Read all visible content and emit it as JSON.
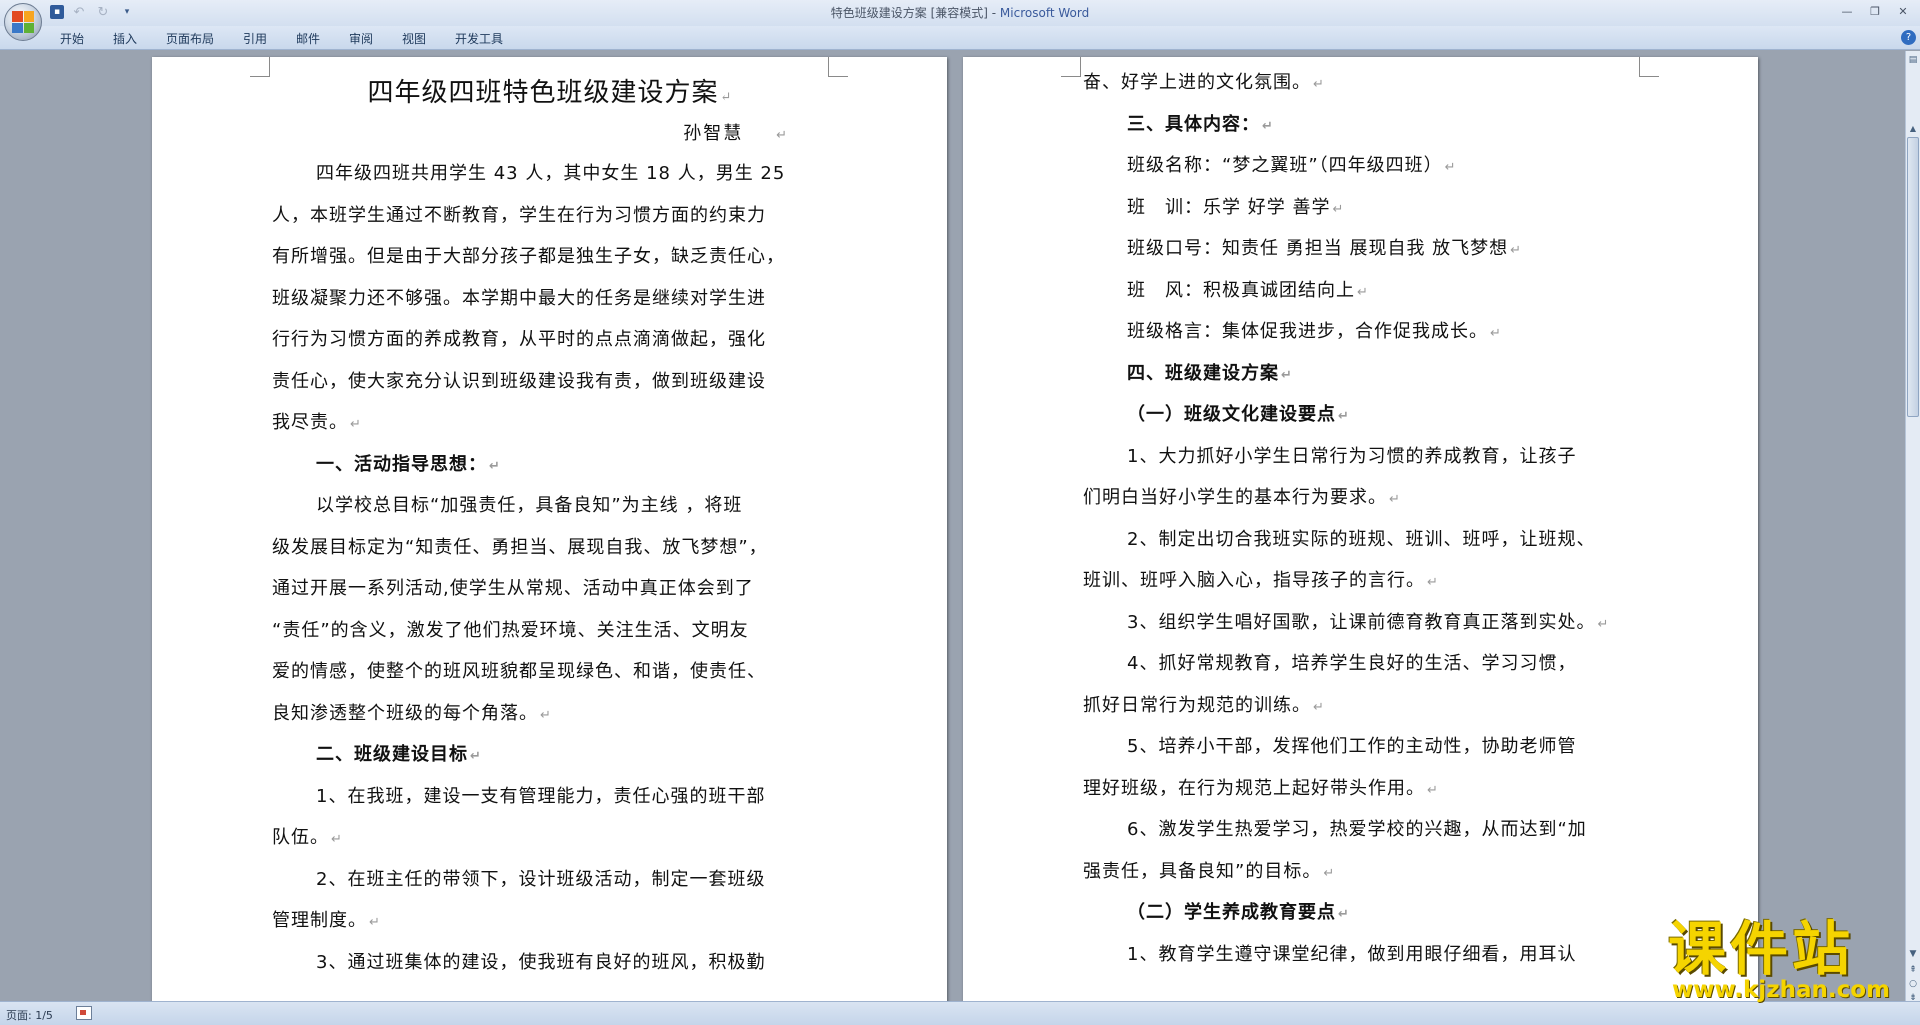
{
  "window": {
    "title_doc": "特色班级建设方案 [兼容模式] - ",
    "title_app": "Microsoft Word"
  },
  "ribbon": {
    "tabs": [
      "开始",
      "插入",
      "页面布局",
      "引用",
      "邮件",
      "审阅",
      "视图",
      "开发工具"
    ]
  },
  "page_left": {
    "title": "四年级四班特色班级建设方案",
    "author": "孙智慧",
    "lines": [
      {
        "text": "四年级四班共用学生 43 人，其中女生 18 人，男生 25",
        "indent": true
      },
      {
        "text": "人，本班学生通过不断教育，学生在行为习惯方面的约束力",
        "indent": false
      },
      {
        "text": "有所增强。但是由于大部分孩子都是独生子女，缺乏责任心，",
        "indent": false
      },
      {
        "text": "班级凝聚力还不够强。本学期中最大的任务是继续对学生进",
        "indent": false
      },
      {
        "text": "行行为习惯方面的养成教育，从平时的点点滴滴做起，强化",
        "indent": false
      },
      {
        "text": "责任心，使大家充分认识到班级建设我有责，做到班级建设",
        "indent": false
      },
      {
        "text": "我尽责。",
        "indent": false,
        "pm": true
      },
      {
        "text": "一、活动指导思想：",
        "indent": true,
        "heading": true,
        "pm": true
      },
      {
        "text": "以学校总目标“加强责任，具备良知”为主线 ，将班",
        "indent": true
      },
      {
        "text": "级发展目标定为“知责任、勇担当、展现自我、放飞梦想”，",
        "indent": false
      },
      {
        "text": "通过开展一系列活动,使学生从常规、活动中真正体会到了",
        "indent": false
      },
      {
        "text": "“责任”的含义，激发了他们热爱环境、关注生活、文明友",
        "indent": false
      },
      {
        "text": "爱的情感，使整个的班风班貌都呈现绿色、和谐，使责任、",
        "indent": false
      },
      {
        "text": "良知渗透整个班级的每个角落。",
        "indent": false,
        "pm": true
      },
      {
        "text": "二、班级建设目标",
        "indent": true,
        "heading": true,
        "pm": true
      },
      {
        "text": "1、在我班，建设一支有管理能力，责任心强的班干部",
        "indent": true
      },
      {
        "text": "队伍。",
        "indent": false,
        "pm": true
      },
      {
        "text": "2、在班主任的带领下，设计班级活动，制定一套班级",
        "indent": true
      },
      {
        "text": "管理制度。",
        "indent": false,
        "pm": true
      },
      {
        "text": "3、通过班集体的建设，使我班有良好的班风，积极勤",
        "indent": true
      }
    ]
  },
  "page_right": {
    "lines": [
      {
        "text": "奋、好学上进的文化氛围。",
        "indent": false,
        "pm": true
      },
      {
        "text": "三、具体内容：",
        "indent": true,
        "heading": true,
        "pm": true
      },
      {
        "text": "班级名称：“梦之翼班”（四年级四班）",
        "indent": true,
        "pm": true
      },
      {
        "text": "班　训：乐学 好学 善学",
        "indent": true,
        "pm": true
      },
      {
        "text": "班级口号：知责任 勇担当 展现自我 放飞梦想",
        "indent": true,
        "pm": true
      },
      {
        "text": "班　风：积极真诚团结向上",
        "indent": true,
        "pm": true
      },
      {
        "text": "班级格言：集体促我进步，合作促我成长。",
        "indent": true,
        "pm": true
      },
      {
        "text": "四、班级建设方案",
        "indent": true,
        "heading": true,
        "pm": true
      },
      {
        "text": "（一）班级文化建设要点",
        "indent": true,
        "heading": true,
        "pm": true
      },
      {
        "text": "1、大力抓好小学生日常行为习惯的养成教育，让孩子",
        "indent": true
      },
      {
        "text": "们明白当好小学生的基本行为要求。",
        "indent": false,
        "pm": true
      },
      {
        "text": "2、制定出切合我班实际的班规、班训、班呼，让班规、",
        "indent": true
      },
      {
        "text": "班训、班呼入脑入心，指导孩子的言行。",
        "indent": false,
        "pm": true
      },
      {
        "text": "3、组织学生唱好国歌，让课前德育教育真正落到实处。",
        "indent": true,
        "pm": true
      },
      {
        "text": "4、抓好常规教育，培养学生良好的生活、学习习惯，",
        "indent": true
      },
      {
        "text": "抓好日常行为规范的训练。",
        "indent": false,
        "pm": true
      },
      {
        "text": "5、培养小干部，发挥他们工作的主动性，协助老师管",
        "indent": true
      },
      {
        "text": "理好班级，在行为规范上起好带头作用。",
        "indent": false,
        "pm": true
      },
      {
        "text": "6、激发学生热爱学习，热爱学校的兴趣，从而达到“加",
        "indent": true
      },
      {
        "text": "强责任，具备良知”的目标。",
        "indent": false,
        "pm": true
      },
      {
        "text": "（二）学生养成教育要点",
        "indent": true,
        "heading": true,
        "pm": true
      },
      {
        "text": "1、教育学生遵守课堂纪律，做到用眼仔细看，用耳认",
        "indent": true
      }
    ]
  },
  "status": {
    "page": "页面: 1/5"
  },
  "watermark": {
    "main": "课件站",
    "url": "www.kjzhan.com"
  },
  "icons": {
    "paragraph_mark": "↵"
  }
}
